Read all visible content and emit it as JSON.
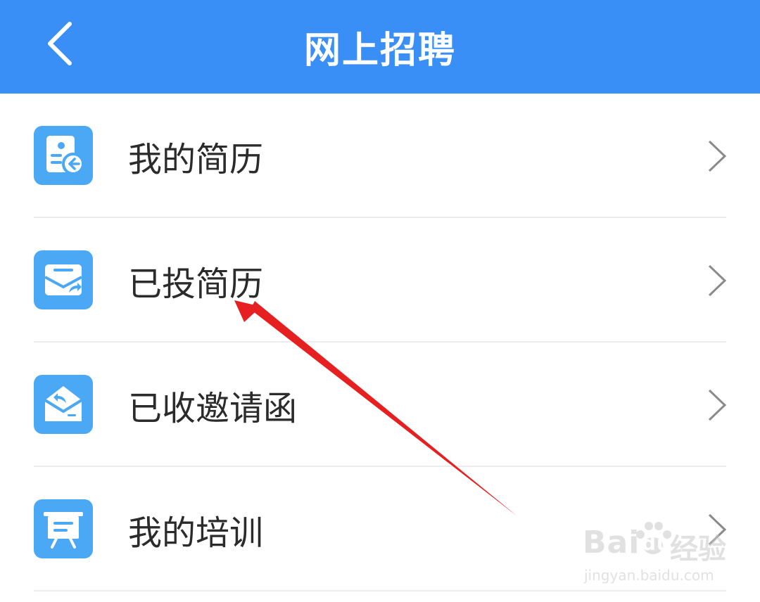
{
  "header": {
    "title": "网上招聘",
    "back_icon": "chevron-left-icon",
    "background": "#3a8ff7"
  },
  "menu": {
    "items": [
      {
        "label": "我的简历",
        "icon": "resume-icon"
      },
      {
        "label": "已投简历",
        "icon": "sent-resume-icon"
      },
      {
        "label": "已收邀请函",
        "icon": "received-invitation-icon"
      },
      {
        "label": "我的培训",
        "icon": "training-board-icon"
      }
    ],
    "icon_color": "#4aa8f5"
  },
  "annotation": {
    "color": "#e62020"
  },
  "watermark": {
    "logo_prefix": "Bai",
    "logo_suffix": "du",
    "brand_cn": "经验",
    "url": "jingyan.baidu.com"
  }
}
